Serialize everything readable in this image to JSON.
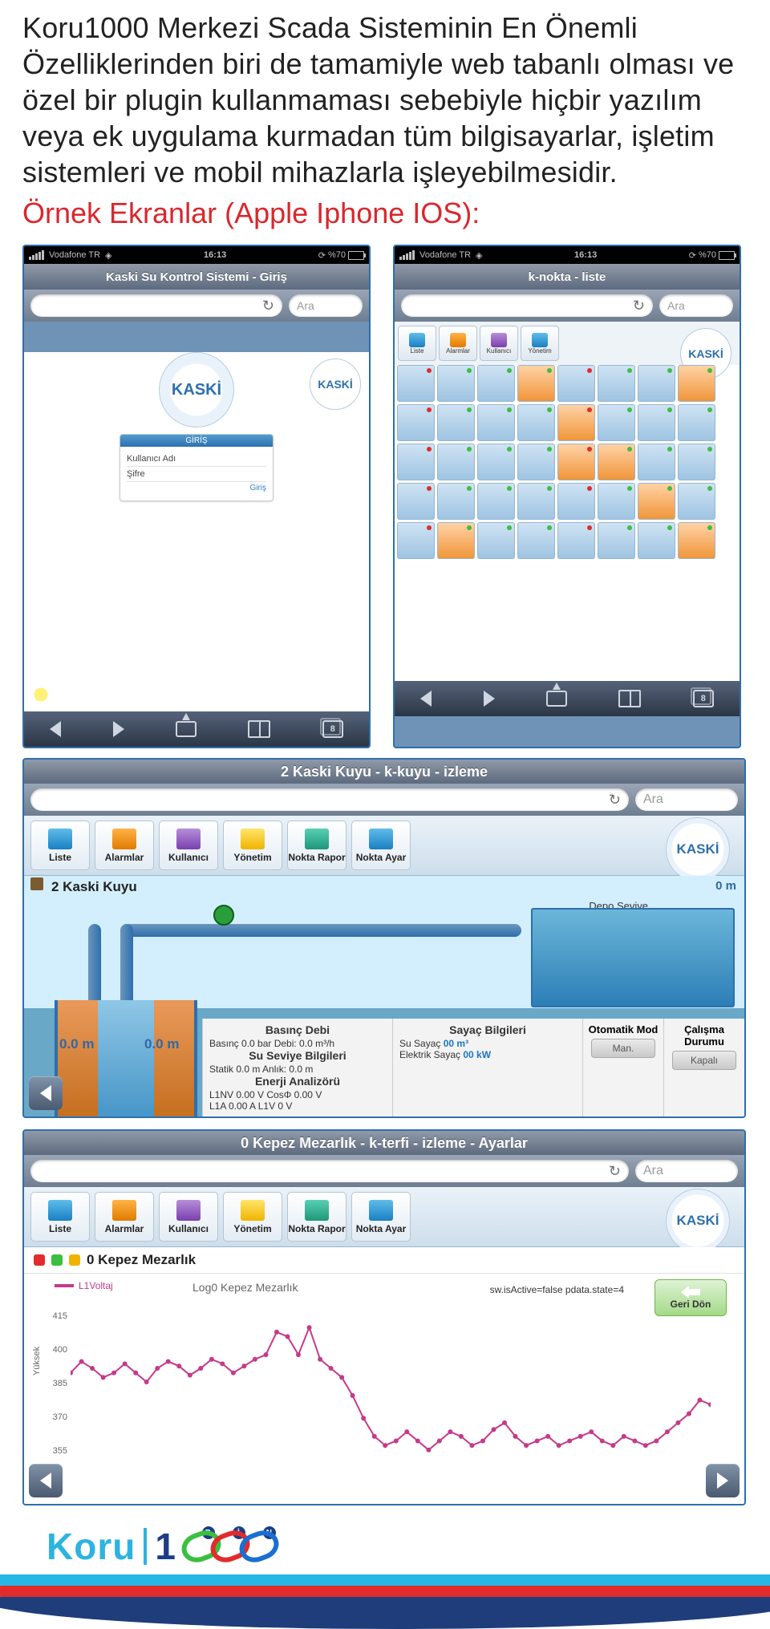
{
  "intro_paragraph": "Koru1000 Merkezi Scada Sisteminin En Önemli Özelliklerinden biri de tamamiyle web tabanlı olması ve özel bir plugin kullanmaması sebebiyle hiçbir yazılım veya ek uygulama kurmadan tüm bilgisayarlar, işletim sistemleri ve mobil mihazlarla işleyebilmesidir.",
  "subheading": "Örnek Ekranlar (Apple Iphone IOS):",
  "phone_common": {
    "carrier": "Vodafone TR",
    "time": "16:13",
    "battery_pct": "%70",
    "reload_glyph": "↻",
    "search_placeholder": "Ara",
    "pages_count": "8"
  },
  "login_screen": {
    "title": "Kaski Su Kontrol Sistemi - Giriş",
    "logo_text": "KASKİ",
    "box_head": "GİRİŞ",
    "field_user": "Kullanıcı Adı",
    "field_pass": "Şifre",
    "btn": "Giriş"
  },
  "list_screen": {
    "title": "k-nokta - liste",
    "toolbar": [
      "Liste",
      "Alarmlar",
      "Kullanıcı",
      "Yönetim"
    ]
  },
  "izleme_screen": {
    "title": "2 Kaski Kuyu - k-kuyu - izleme",
    "toolbar": [
      "Liste",
      "Alarmlar",
      "Kullanıcı",
      "Yönetim",
      "Nokta Rapor",
      "Nokta Ayar"
    ],
    "station": "2 Kaski Kuyu",
    "depth": "0 m",
    "depo_label": "Depo Seviye",
    "reading_1": "0.0 m",
    "reading_2": "0.0 m",
    "cards": {
      "c1_title": "Basınç Debi",
      "c1_l1": "Basınç 0.0 bar   Debi: 0.0 m³/h",
      "c2_title": "Su Seviye Bilgileri",
      "c2_l1": "Statik 0.0 m   Anlık: 0.0 m",
      "c3_title": "Enerji Analizörü",
      "c3_l1": "L1NV 0.00 V   CosΦ 0.00 V",
      "c3_l2": "L1A 0.00 A   L1V 0 V",
      "c4_title": "Sayaç Bilgileri",
      "c4_l1a": "Su Sayaç",
      "c4_l1b": "00 m³",
      "c4_l2a": "Elektrik Sayaç",
      "c4_l2b": "00 kW",
      "c5_title": "Otomatik Mod",
      "c5_btn": "Man.",
      "c6_title": "Çalışma Durumu",
      "c6_btn": "Kapalı"
    }
  },
  "ayarlar_screen": {
    "title": "0 Kepez Mezarlık - k-terfi - izleme - Ayarlar",
    "toolbar": [
      "Liste",
      "Alarmlar",
      "Kullanıcı",
      "Yönetim",
      "Nokta Rapor",
      "Nokta Ayar"
    ],
    "station": "0 Kepez Mezarlık",
    "legend_label": "L1Voltaj",
    "chart_caption": "Log0 Kepez Mezarlık",
    "status_text": "sw.isActive=false pdata.state=4",
    "back_btn": "Geri Dön",
    "ylabel": "Yüksek"
  },
  "chart_data": {
    "type": "line",
    "title": "Log0 Kepez Mezarlık",
    "ylabel": "Yüksek",
    "series_name": "L1Voltaj",
    "ylim": [
      340,
      415
    ],
    "yticks": [
      415,
      400,
      385,
      370,
      355
    ],
    "x": [
      0,
      1,
      2,
      3,
      4,
      5,
      6,
      7,
      8,
      9,
      10,
      11,
      12,
      13,
      14,
      15,
      16,
      17,
      18,
      19,
      20,
      21,
      22,
      23,
      24,
      25,
      26,
      27,
      28,
      29,
      30,
      31,
      32,
      33,
      34,
      35,
      36,
      37,
      38,
      39,
      40,
      41,
      42,
      43,
      44,
      45,
      46,
      47,
      48,
      49,
      50,
      51,
      52,
      53,
      54,
      55,
      56,
      57,
      58,
      59
    ],
    "values": [
      390,
      395,
      392,
      388,
      390,
      394,
      390,
      386,
      392,
      395,
      393,
      389,
      392,
      396,
      394,
      390,
      393,
      396,
      398,
      408,
      406,
      398,
      410,
      396,
      392,
      388,
      380,
      370,
      362,
      358,
      360,
      364,
      360,
      356,
      360,
      364,
      362,
      358,
      360,
      365,
      368,
      362,
      358,
      360,
      362,
      358,
      360,
      362,
      364,
      360,
      358,
      362,
      360,
      358,
      360,
      364,
      368,
      372,
      378,
      376
    ]
  },
  "brand": {
    "name_1": "Koru",
    "name_2": "1",
    "letters": [
      "B",
      "İ",
      "N"
    ]
  }
}
